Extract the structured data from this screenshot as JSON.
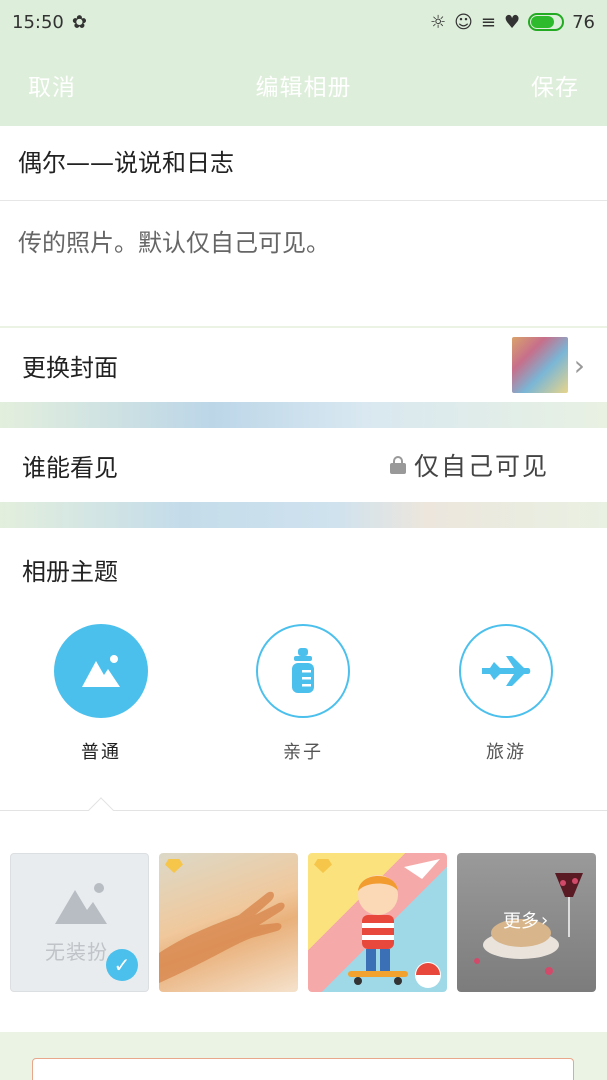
{
  "status_bar": {
    "time": "15:50",
    "battery_level": "76",
    "battery_fraction": 0.76
  },
  "navbar": {
    "cancel": "取消",
    "title": "编辑相册",
    "save": "保存"
  },
  "album": {
    "name": "偶尔——说说和日志",
    "description": "传的照片。默认仅自己可见。"
  },
  "cover": {
    "label": "更换封面"
  },
  "visibility": {
    "label": "谁能看见",
    "value": "仅自己可见"
  },
  "theme": {
    "title": "相册主题",
    "options": [
      {
        "label": "普通",
        "icon": "mountain-image-icon",
        "selected": true
      },
      {
        "label": "亲子",
        "icon": "baby-bottle-icon",
        "selected": false
      },
      {
        "label": "旅游",
        "icon": "airplane-icon",
        "selected": false
      }
    ]
  },
  "skins": {
    "none_label": "无装扮",
    "more_label": "更多"
  },
  "colors": {
    "accent": "#4cc0ec",
    "header_bg": "#ddeeda"
  }
}
